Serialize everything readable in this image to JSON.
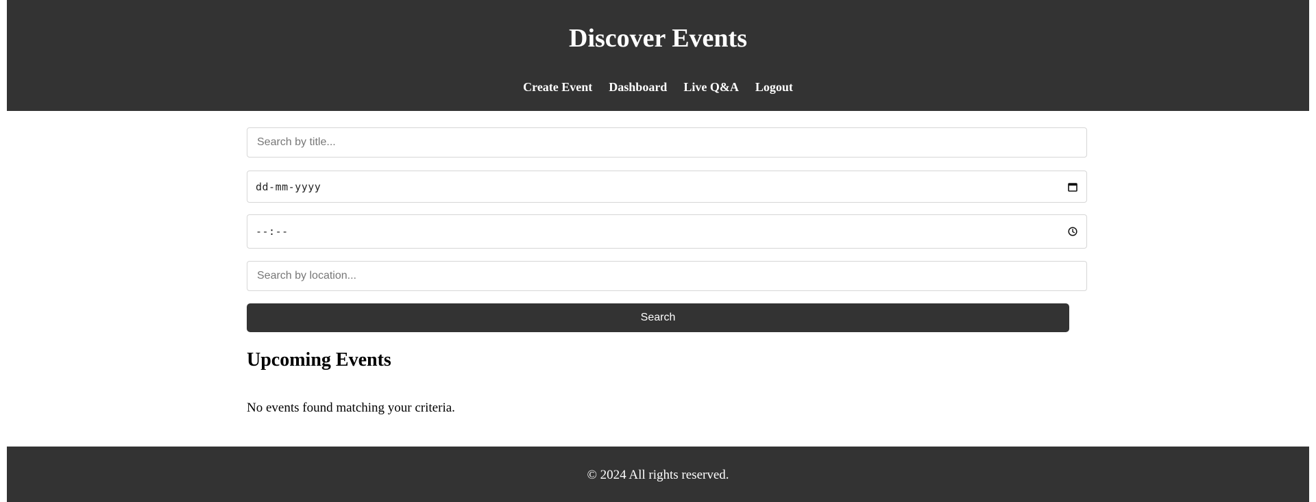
{
  "header": {
    "title": "Discover Events",
    "nav": [
      {
        "label": "Create Event"
      },
      {
        "label": "Dashboard"
      },
      {
        "label": "Live Q&A"
      },
      {
        "label": "Logout"
      }
    ]
  },
  "search": {
    "title_placeholder": "Search by title...",
    "date_placeholder": "dd-mm-yyyy",
    "time_placeholder": "--:--",
    "location_placeholder": "Search by location...",
    "button_label": "Search",
    "date_icon": "calendar-icon",
    "time_icon": "clock-icon"
  },
  "events": {
    "heading": "Upcoming Events",
    "empty_message": "No events found matching your criteria."
  },
  "footer": {
    "copyright": "© 2024 All rights reserved."
  },
  "colors": {
    "bar_background": "#333333",
    "bar_text": "#ffffff",
    "button_background": "#333333",
    "input_border": "#d6d6d6"
  }
}
